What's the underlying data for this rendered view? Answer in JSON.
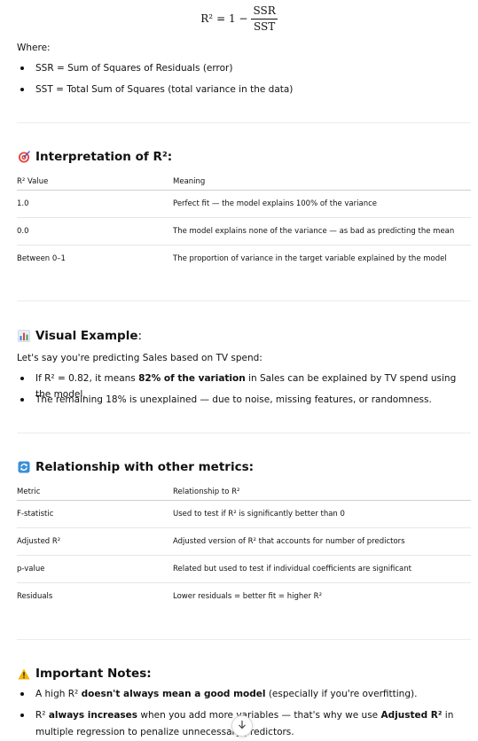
{
  "formula": {
    "lhs": "R²",
    "equals": "= 1 −",
    "numerator": "SSR",
    "denominator": "SST"
  },
  "where_label": "Where:",
  "definitions": [
    "SSR = Sum of Squares of Residuals (error)",
    "SST = Total Sum of Squares (total variance in the data)"
  ],
  "interpretation": {
    "icon": "target-icon",
    "title": "Interpretation of R²:",
    "headers": [
      "R² Value",
      "Meaning"
    ],
    "rows": [
      [
        "1.0",
        "Perfect fit — the model explains 100% of the variance"
      ],
      [
        "0.0",
        "The model explains none of the variance — as bad as predicting the mean"
      ],
      [
        "Between 0–1",
        "The proportion of variance in the target variable explained by the model"
      ]
    ]
  },
  "visual": {
    "icon": "bar-chart-icon",
    "title_bold": "Visual Example",
    "title_rest": ":",
    "intro": "Let's say you're predicting Sales based on TV spend:",
    "bullet1_pre": "If R² = 0.82, it means ",
    "bullet1_bold": "82% of the variation",
    "bullet1_post": " in Sales can be explained by TV spend using the model.",
    "bullet2": "The remaining 18% is unexplained — due to noise, missing features, or randomness."
  },
  "relationship": {
    "icon": "arrows-cycle-icon",
    "title": "Relationship with other metrics:",
    "headers": [
      "Metric",
      "Relationship to R²"
    ],
    "rows": [
      [
        "F-statistic",
        "Used to test if R² is significantly better than 0"
      ],
      [
        "Adjusted R²",
        "Adjusted version of R² that accounts for number of predictors"
      ],
      [
        "p-value",
        "Related but used to test if individual coefficients are significant"
      ],
      [
        "Residuals",
        "Lower residuals = better fit = higher R²"
      ]
    ]
  },
  "notes": {
    "icon": "warning-icon",
    "title": "Important Notes:",
    "n1_pre": "A high R² ",
    "n1_bold1": "doesn't always mean a good model",
    "n1_post": " (especially if you're overfitting).",
    "n2_pre": "R² ",
    "n2_bold1": "always increases",
    "n2_mid": " when you add more variables — that's why we use ",
    "n2_bold2": "Adjusted R²",
    "n2_post": " in multiple regression to penalize unnecessary predictors."
  },
  "scroll_down_icon": "arrow-down-icon",
  "colors": {
    "target_red": "#e0453a",
    "chart_blue": "#3b7ddd",
    "cycle_blue": "#3a8fd8",
    "warning_yellow": "#f2b705"
  }
}
